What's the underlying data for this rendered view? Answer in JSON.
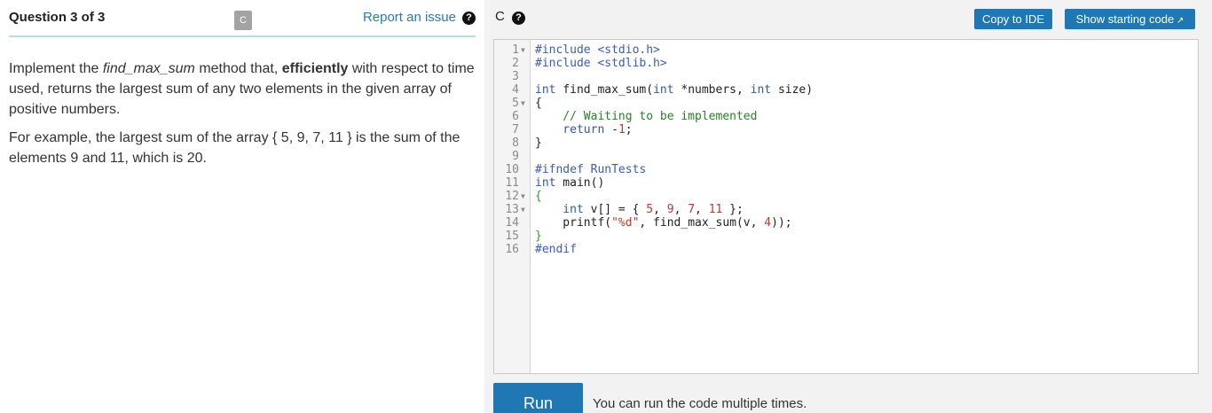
{
  "question": {
    "title": "Question 3 of 3",
    "language_badge": "C",
    "report_label": "Report an issue",
    "help_icon": "question-circle-icon"
  },
  "description": {
    "p1_intro": "Implement the ",
    "p1_method": "find_max_sum",
    "p1_mid": " method that, ",
    "p1_bold": "efficiently",
    "p1_rest": " with respect to time used, returns the largest sum of any two elements in the given array of positive numbers.",
    "p2": "For example, the largest sum of the array { 5, 9, 7, 11 } is the sum of the elements 9 and 11, which is 20."
  },
  "editor": {
    "language": "C",
    "copy_label": "Copy to IDE",
    "start_label": "Show starting code",
    "start_icon": "external-link-icon",
    "lines": [
      {
        "n": "1",
        "fold": true
      },
      {
        "n": "2",
        "fold": false
      },
      {
        "n": "3",
        "fold": false
      },
      {
        "n": "4",
        "fold": false
      },
      {
        "n": "5",
        "fold": true
      },
      {
        "n": "6",
        "fold": false
      },
      {
        "n": "7",
        "fold": false
      },
      {
        "n": "8",
        "fold": false
      },
      {
        "n": "9",
        "fold": false
      },
      {
        "n": "10",
        "fold": false
      },
      {
        "n": "11",
        "fold": false
      },
      {
        "n": "12",
        "fold": true
      },
      {
        "n": "13",
        "fold": true
      },
      {
        "n": "14",
        "fold": false
      },
      {
        "n": "15",
        "fold": false
      },
      {
        "n": "16",
        "fold": false
      }
    ],
    "code": {
      "l1": "#include <stdio.h>",
      "l2": "#include <stdlib.h>",
      "l4_type": "int",
      "l4_name": " find_max_sum(",
      "l4_t2": "int",
      "l4_p1": " *numbers, ",
      "l4_t3": "int",
      "l4_p2": " size)",
      "l5": "{",
      "l6": "    // Waiting to be implemented",
      "l7_kw": "    return",
      "l7_rest": " -",
      "l7_num": "1",
      "l7_end": ";",
      "l8": "}",
      "l10": "#ifndef RunTests",
      "l11_type": "int",
      "l11_rest": " main()",
      "l12": "{",
      "l13_type": "    int",
      "l13_a": " v[] = { ",
      "l13_n1": "5",
      "l13_c1": ", ",
      "l13_n2": "9",
      "l13_c2": ", ",
      "l13_n3": "7",
      "l13_c3": ", ",
      "l13_n4": "11",
      "l13_end": " };",
      "l14_a": "    printf(",
      "l14_str": "\"%d\"",
      "l14_b": ", find_max_sum(v, ",
      "l14_num": "4",
      "l14_end": "));",
      "l15": "}",
      "l16": "#endif"
    }
  },
  "run": {
    "button_label": "Run",
    "note": "You can run the code multiple times."
  },
  "colors": {
    "accent_blue": "#1f77b4",
    "link_blue": "#2a7ab0",
    "header_rule": "#b9dce8",
    "panel_gray": "#f2f2f2"
  }
}
